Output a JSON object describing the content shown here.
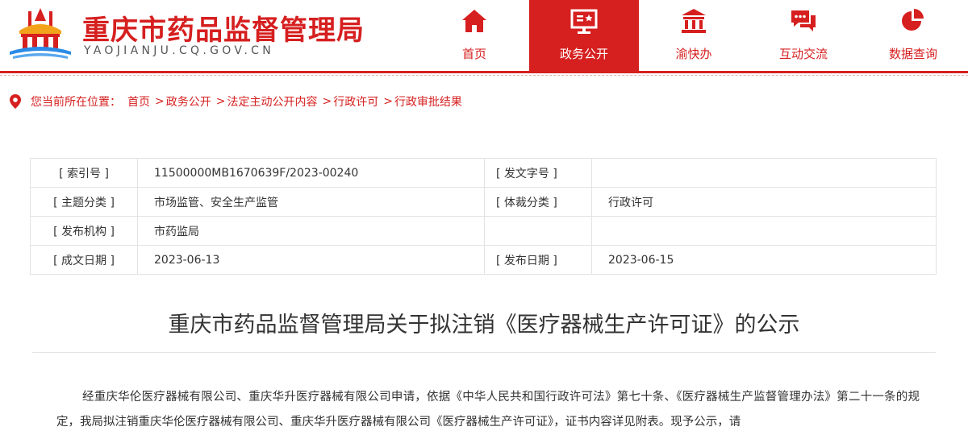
{
  "header": {
    "site_title": "重庆市药品监督管理局",
    "site_domain": "YAOJIANJU.CQ.GOV.CN"
  },
  "nav": [
    {
      "label": "首页",
      "icon": "home-icon"
    },
    {
      "label": "政务公开",
      "icon": "gov-info-icon",
      "active": true
    },
    {
      "label": "渝快办",
      "icon": "building-icon"
    },
    {
      "label": "互动交流",
      "icon": "chat-icon"
    },
    {
      "label": "数据查询",
      "icon": "pie-chart-icon"
    }
  ],
  "breadcrumb": {
    "prefix": "您当前所在位置：",
    "items": [
      "首页",
      "政务公开",
      "法定主动公开内容",
      "行政许可",
      "行政审批结果"
    ],
    "sep": ">"
  },
  "meta": {
    "rows": [
      [
        "[ 索引号 ]",
        "11500000MB1670639F/2023-00240",
        "[ 发文字号 ]",
        ""
      ],
      [
        "[ 主题分类 ]",
        "市场监管、安全生产监管",
        "[ 体裁分类 ]",
        "行政许可"
      ],
      [
        "[ 发布机构 ]",
        "市药监局",
        "",
        ""
      ],
      [
        "[ 成文日期 ]",
        "2023-06-13",
        "[ 发布日期 ]",
        "2023-06-15"
      ]
    ]
  },
  "article": {
    "title": "重庆市药品监督管理局关于拟注销《医疗器械生产许可证》的公示",
    "body": "经重庆华伦医疗器械有限公司、重庆华升医疗器械有限公司申请，依据《中华人民共和国行政许可法》第七十条、《医疗器械生产监督管理办法》第二十一条的规定，我局拟注销重庆华伦医疗器械有限公司、重庆华升医疗器械有限公司《医疗器械生产许可证》，证书内容详见附表。现予公示，请"
  },
  "colors": {
    "brand_red": "#d61f1f"
  }
}
